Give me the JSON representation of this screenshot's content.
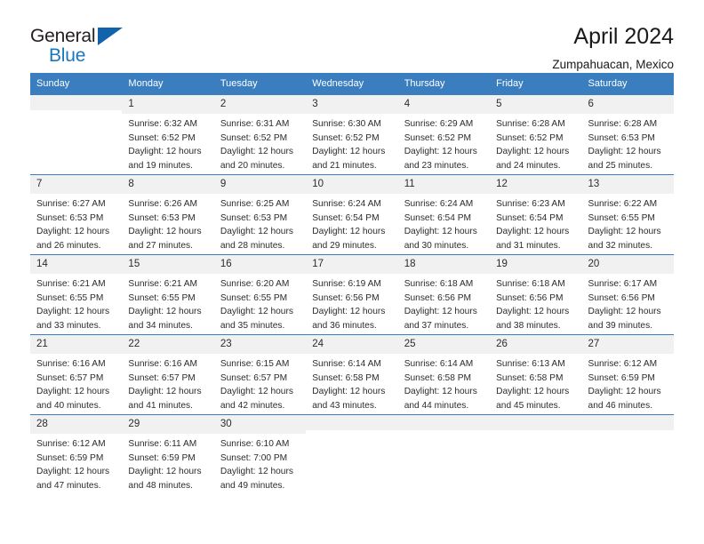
{
  "brand": {
    "name_part1": "General",
    "name_part2": "Blue",
    "triangle_color": "#1163ab",
    "blue_color": "#1878be"
  },
  "header": {
    "title": "April 2024",
    "subtitle": "Zumpahuacan, Mexico"
  },
  "theme": {
    "header_bg": "#3a7ebf",
    "header_text": "#ffffff",
    "daynum_bg": "#f1f1f1",
    "text": "#2b2b2b",
    "page_bg": "#ffffff"
  },
  "weekdays": [
    "Sunday",
    "Monday",
    "Tuesday",
    "Wednesday",
    "Thursday",
    "Friday",
    "Saturday"
  ],
  "labels": {
    "sunrise_prefix": "Sunrise:",
    "sunset_prefix": "Sunset:",
    "daylight_prefix": "Daylight:"
  },
  "weeks": [
    [
      {
        "day": "",
        "empty": true
      },
      {
        "day": "1",
        "sunrise": "Sunrise: 6:32 AM",
        "sunset": "Sunset: 6:52 PM",
        "daylight1": "Daylight: 12 hours",
        "daylight2": "and 19 minutes."
      },
      {
        "day": "2",
        "sunrise": "Sunrise: 6:31 AM",
        "sunset": "Sunset: 6:52 PM",
        "daylight1": "Daylight: 12 hours",
        "daylight2": "and 20 minutes."
      },
      {
        "day": "3",
        "sunrise": "Sunrise: 6:30 AM",
        "sunset": "Sunset: 6:52 PM",
        "daylight1": "Daylight: 12 hours",
        "daylight2": "and 21 minutes."
      },
      {
        "day": "4",
        "sunrise": "Sunrise: 6:29 AM",
        "sunset": "Sunset: 6:52 PM",
        "daylight1": "Daylight: 12 hours",
        "daylight2": "and 23 minutes."
      },
      {
        "day": "5",
        "sunrise": "Sunrise: 6:28 AM",
        "sunset": "Sunset: 6:52 PM",
        "daylight1": "Daylight: 12 hours",
        "daylight2": "and 24 minutes."
      },
      {
        "day": "6",
        "sunrise": "Sunrise: 6:28 AM",
        "sunset": "Sunset: 6:53 PM",
        "daylight1": "Daylight: 12 hours",
        "daylight2": "and 25 minutes."
      }
    ],
    [
      {
        "day": "7",
        "sunrise": "Sunrise: 6:27 AM",
        "sunset": "Sunset: 6:53 PM",
        "daylight1": "Daylight: 12 hours",
        "daylight2": "and 26 minutes."
      },
      {
        "day": "8",
        "sunrise": "Sunrise: 6:26 AM",
        "sunset": "Sunset: 6:53 PM",
        "daylight1": "Daylight: 12 hours",
        "daylight2": "and 27 minutes."
      },
      {
        "day": "9",
        "sunrise": "Sunrise: 6:25 AM",
        "sunset": "Sunset: 6:53 PM",
        "daylight1": "Daylight: 12 hours",
        "daylight2": "and 28 minutes."
      },
      {
        "day": "10",
        "sunrise": "Sunrise: 6:24 AM",
        "sunset": "Sunset: 6:54 PM",
        "daylight1": "Daylight: 12 hours",
        "daylight2": "and 29 minutes."
      },
      {
        "day": "11",
        "sunrise": "Sunrise: 6:24 AM",
        "sunset": "Sunset: 6:54 PM",
        "daylight1": "Daylight: 12 hours",
        "daylight2": "and 30 minutes."
      },
      {
        "day": "12",
        "sunrise": "Sunrise: 6:23 AM",
        "sunset": "Sunset: 6:54 PM",
        "daylight1": "Daylight: 12 hours",
        "daylight2": "and 31 minutes."
      },
      {
        "day": "13",
        "sunrise": "Sunrise: 6:22 AM",
        "sunset": "Sunset: 6:55 PM",
        "daylight1": "Daylight: 12 hours",
        "daylight2": "and 32 minutes."
      }
    ],
    [
      {
        "day": "14",
        "sunrise": "Sunrise: 6:21 AM",
        "sunset": "Sunset: 6:55 PM",
        "daylight1": "Daylight: 12 hours",
        "daylight2": "and 33 minutes."
      },
      {
        "day": "15",
        "sunrise": "Sunrise: 6:21 AM",
        "sunset": "Sunset: 6:55 PM",
        "daylight1": "Daylight: 12 hours",
        "daylight2": "and 34 minutes."
      },
      {
        "day": "16",
        "sunrise": "Sunrise: 6:20 AM",
        "sunset": "Sunset: 6:55 PM",
        "daylight1": "Daylight: 12 hours",
        "daylight2": "and 35 minutes."
      },
      {
        "day": "17",
        "sunrise": "Sunrise: 6:19 AM",
        "sunset": "Sunset: 6:56 PM",
        "daylight1": "Daylight: 12 hours",
        "daylight2": "and 36 minutes."
      },
      {
        "day": "18",
        "sunrise": "Sunrise: 6:18 AM",
        "sunset": "Sunset: 6:56 PM",
        "daylight1": "Daylight: 12 hours",
        "daylight2": "and 37 minutes."
      },
      {
        "day": "19",
        "sunrise": "Sunrise: 6:18 AM",
        "sunset": "Sunset: 6:56 PM",
        "daylight1": "Daylight: 12 hours",
        "daylight2": "and 38 minutes."
      },
      {
        "day": "20",
        "sunrise": "Sunrise: 6:17 AM",
        "sunset": "Sunset: 6:56 PM",
        "daylight1": "Daylight: 12 hours",
        "daylight2": "and 39 minutes."
      }
    ],
    [
      {
        "day": "21",
        "sunrise": "Sunrise: 6:16 AM",
        "sunset": "Sunset: 6:57 PM",
        "daylight1": "Daylight: 12 hours",
        "daylight2": "and 40 minutes."
      },
      {
        "day": "22",
        "sunrise": "Sunrise: 6:16 AM",
        "sunset": "Sunset: 6:57 PM",
        "daylight1": "Daylight: 12 hours",
        "daylight2": "and 41 minutes."
      },
      {
        "day": "23",
        "sunrise": "Sunrise: 6:15 AM",
        "sunset": "Sunset: 6:57 PM",
        "daylight1": "Daylight: 12 hours",
        "daylight2": "and 42 minutes."
      },
      {
        "day": "24",
        "sunrise": "Sunrise: 6:14 AM",
        "sunset": "Sunset: 6:58 PM",
        "daylight1": "Daylight: 12 hours",
        "daylight2": "and 43 minutes."
      },
      {
        "day": "25",
        "sunrise": "Sunrise: 6:14 AM",
        "sunset": "Sunset: 6:58 PM",
        "daylight1": "Daylight: 12 hours",
        "daylight2": "and 44 minutes."
      },
      {
        "day": "26",
        "sunrise": "Sunrise: 6:13 AM",
        "sunset": "Sunset: 6:58 PM",
        "daylight1": "Daylight: 12 hours",
        "daylight2": "and 45 minutes."
      },
      {
        "day": "27",
        "sunrise": "Sunrise: 6:12 AM",
        "sunset": "Sunset: 6:59 PM",
        "daylight1": "Daylight: 12 hours",
        "daylight2": "and 46 minutes."
      }
    ],
    [
      {
        "day": "28",
        "sunrise": "Sunrise: 6:12 AM",
        "sunset": "Sunset: 6:59 PM",
        "daylight1": "Daylight: 12 hours",
        "daylight2": "and 47 minutes."
      },
      {
        "day": "29",
        "sunrise": "Sunrise: 6:11 AM",
        "sunset": "Sunset: 6:59 PM",
        "daylight1": "Daylight: 12 hours",
        "daylight2": "and 48 minutes."
      },
      {
        "day": "30",
        "sunrise": "Sunrise: 6:10 AM",
        "sunset": "Sunset: 7:00 PM",
        "daylight1": "Daylight: 12 hours",
        "daylight2": "and 49 minutes."
      },
      {
        "day": "",
        "empty": true
      },
      {
        "day": "",
        "empty": true
      },
      {
        "day": "",
        "empty": true
      },
      {
        "day": "",
        "empty": true
      }
    ]
  ]
}
